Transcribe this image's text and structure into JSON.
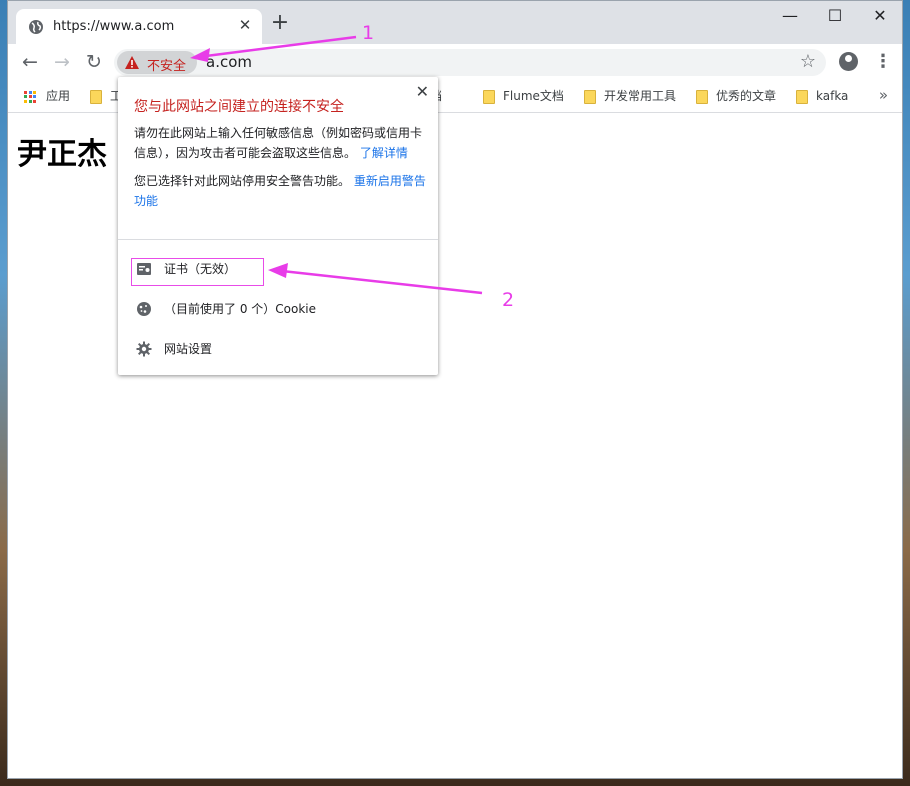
{
  "tab": {
    "title": "https://www.a.com"
  },
  "toolbar": {
    "security_label": "不安全",
    "url": "a.com"
  },
  "bookmarks": [
    {
      "label": "应用",
      "icon": "apps-grid-icon"
    },
    {
      "label": "工",
      "icon": "folder-icon"
    },
    {
      "label": "文档",
      "icon": "folder-icon"
    },
    {
      "label": "Flume文档",
      "icon": "folder-icon"
    },
    {
      "label": "开发常用工具",
      "icon": "folder-icon"
    },
    {
      "label": "优秀的文章",
      "icon": "folder-icon"
    },
    {
      "label": "kafka",
      "icon": "folder-icon"
    }
  ],
  "page": {
    "heading": "尹正杰"
  },
  "popup": {
    "title": "您与此网站之间建立的连接不安全",
    "warning_text": "请勿在此网站上输入任何敏感信息（例如密码或信用卡信息），因为攻击者可能会盗取这些信息。",
    "learn_more": "了解详情",
    "disabled_text": "您已选择针对此网站停用安全警告功能。",
    "reenable": "重新启用警告功能",
    "items": [
      {
        "label": "证书（无效）",
        "icon": "certificate-icon"
      },
      {
        "label": "（目前使用了 0 个）Cookie",
        "icon": "cookie-icon"
      },
      {
        "label": "网站设置",
        "icon": "gear-icon"
      }
    ]
  },
  "annotations": {
    "label_1": "1",
    "label_2": "2",
    "color": "#e83ce8"
  },
  "colors": {
    "warning_red": "#c5221f",
    "link_blue": "#1a73e8",
    "tabstrip_gray": "#dee1e6"
  }
}
